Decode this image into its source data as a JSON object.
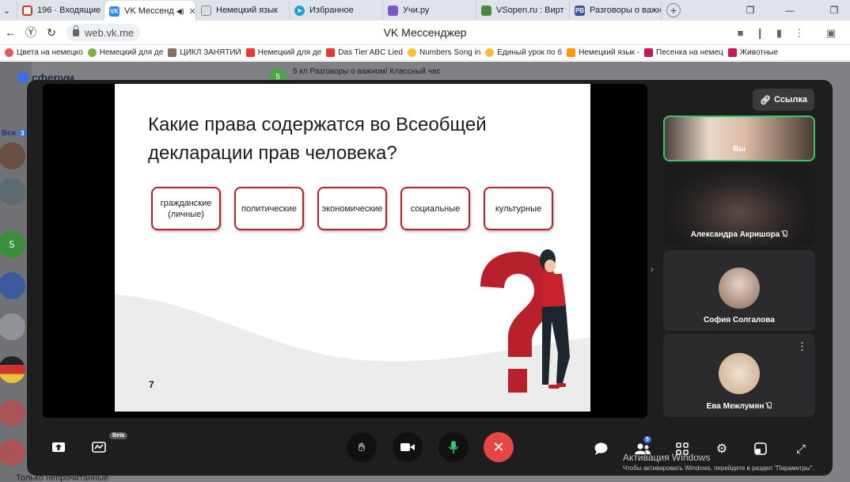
{
  "browser": {
    "tabs": [
      {
        "label": "196 · Входящие",
        "icon_color": "#d93025",
        "icon": "gmail-icon",
        "active": false
      },
      {
        "label": "VK Мессенд",
        "icon_color": "#2787f5",
        "icon": "vk-icon",
        "active": true
      },
      {
        "label": "Немецкий язык",
        "icon_color": "#6b6b6b",
        "icon": "doc-icon",
        "active": false
      },
      {
        "label": "Избранное",
        "icon_color": "#229ed9",
        "icon": "telegram-icon",
        "active": false
      },
      {
        "label": "Учи.ру",
        "icon_color": "#7a57c8",
        "icon": "uchi-icon",
        "active": false
      },
      {
        "label": "VSopen.ru : Вирт",
        "icon_color": "#4a8a3a",
        "icon": "vsopen-icon",
        "active": false
      },
      {
        "label": "Разговоры о важн",
        "icon_color": "#3c4ea0",
        "icon": "pb-icon",
        "active": false
      }
    ],
    "url": "web.vk.me",
    "page_title": "VK Мессенджер",
    "bookmarks": [
      {
        "label": "Цвета на немецко",
        "color": "#e05a5a"
      },
      {
        "label": "Немецкий для де",
        "color": "#7cb342"
      },
      {
        "label": "ЦИКЛ ЗАНЯТИЙ",
        "color": "#8d6e63"
      },
      {
        "label": "Немецкий для де",
        "color": "#e53935"
      },
      {
        "label": "Das Tier ABC Lied",
        "color": "#e53935"
      },
      {
        "label": "Numbers Song in",
        "color": "#fbc02d"
      },
      {
        "label": "Единый урок по б",
        "color": "#fbc02d"
      },
      {
        "label": "Немецкий язык -",
        "color": "#ff9800"
      },
      {
        "label": "Песенка на немец",
        "color": "#c2185b"
      },
      {
        "label": "Животные",
        "color": "#c2185b"
      }
    ]
  },
  "vk": {
    "brand": "сферум",
    "chat_title": "5 кл Разговоры о важном/ Классный час",
    "chat_avatar": "5",
    "filter_all": "Все",
    "filter_count": "3",
    "left_avatar_letter": "5",
    "bottom_note": "Только непрочитанные"
  },
  "slide": {
    "title": "Какие права содержатся во Всеобщей декларации прав человека?",
    "cards": [
      "гражданские (личные)",
      "политические",
      "экономические",
      "социальные",
      "культурные"
    ],
    "page_number": "7",
    "accent_color": "#b8202b"
  },
  "call": {
    "link_button": "Ссылка",
    "participants": [
      {
        "name": "Вы",
        "muted": false
      },
      {
        "name": "Александра Акришора",
        "muted": true
      },
      {
        "name": "София Солгалова",
        "muted": false
      },
      {
        "name": "Ева Межлумян",
        "muted": true
      }
    ],
    "controls": {
      "beta_label": "Beta",
      "participants_count": "5",
      "end_call_color": "#e64646"
    },
    "activation_title": "Активация Windows",
    "activation_text": "Чтобы активировать Windows, перейдите в раздел \"Параметры\"."
  }
}
